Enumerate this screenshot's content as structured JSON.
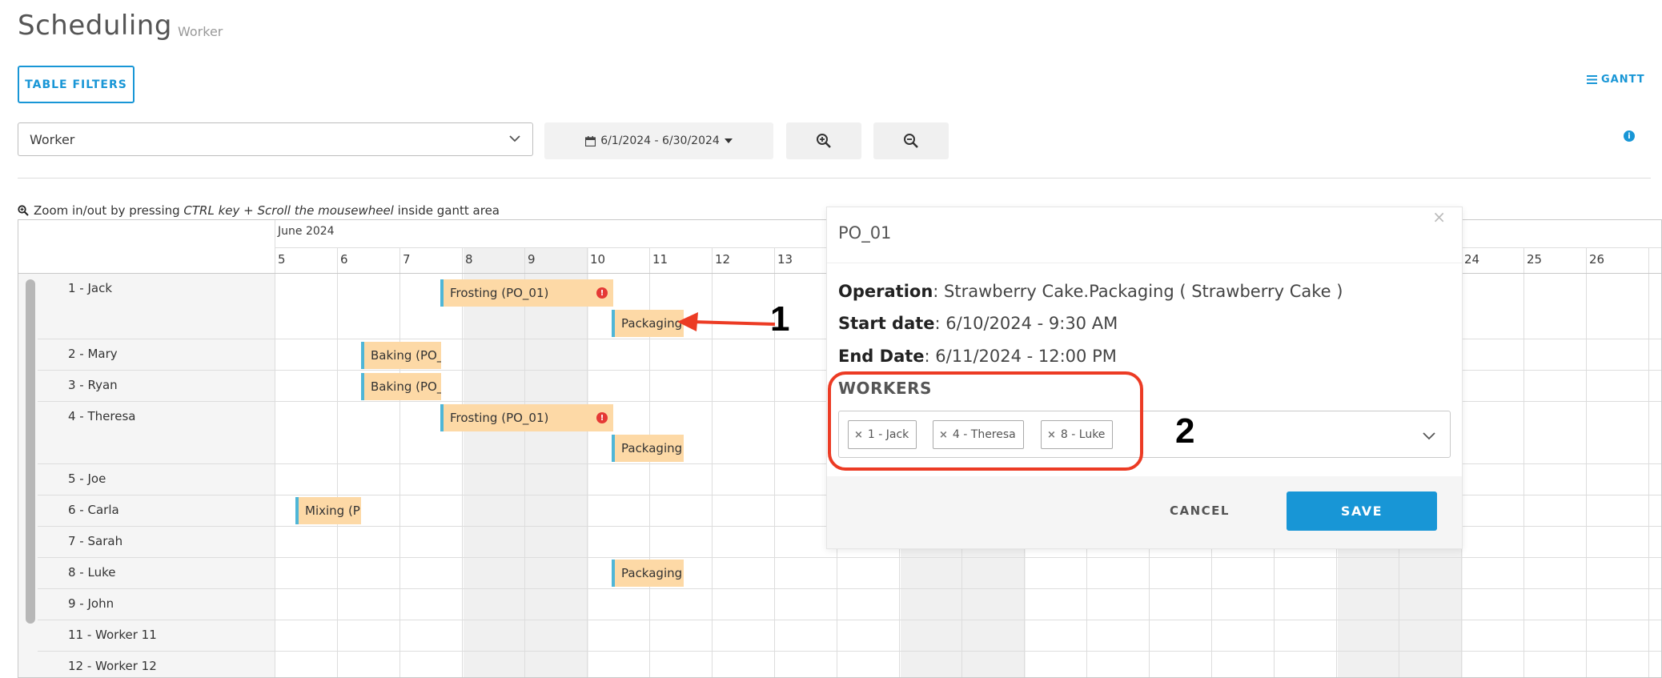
{
  "header": {
    "title": "Scheduling",
    "subtitle": "Worker"
  },
  "toolbar": {
    "filters_label": "TABLE FILTERS",
    "gantt_label": "GANTT",
    "view_select_value": "Worker",
    "date_range": "6/1/2024 - 6/30/2024",
    "zoom_hint_prefix": "Zoom in/out by pressing ",
    "zoom_hint_key": "CTRL key + Scroll the mousewheel",
    "zoom_hint_suffix": " inside gantt area"
  },
  "gantt": {
    "month": "June 2024",
    "days": [
      "5",
      "6",
      "7",
      "8",
      "9",
      "10",
      "11",
      "12",
      "13",
      "24",
      "25",
      "26"
    ],
    "rows": [
      "1 - Jack",
      "2 - Mary",
      "3 - Ryan",
      "4 - Theresa",
      "5 - Joe",
      "6 - Carla",
      "7 - Sarah",
      "8 - Luke",
      "9 - John",
      "11 - Worker 11",
      "12 - Worker 12"
    ],
    "tasks": [
      "Frosting (PO_01)",
      "Packaging",
      "Baking (PO_",
      "Baking (PO_",
      "Frosting (PO_01)",
      "Packaging",
      "Mixing (P",
      "Packaging"
    ]
  },
  "popup": {
    "title": "PO_01",
    "operation_label": "Operation",
    "operation_value": ": Strawberry Cake.Packaging ( Strawberry Cake )",
    "start_label": "Start date",
    "start_value": ": 6/10/2024 - 9:30 AM",
    "end_label": "End Date",
    "end_value": ": 6/11/2024 - 12:00 PM",
    "workers_heading": "WORKERS",
    "workers": [
      "1 - Jack",
      "4 - Theresa",
      "8 - Luke"
    ],
    "cancel_label": "CANCEL",
    "save_label": "SAVE"
  },
  "annotations": {
    "one": "1",
    "two": "2"
  },
  "colors": {
    "accent": "#1896d6",
    "task_fill": "#fdd9a6",
    "task_edge": "#4fb6d7",
    "warning": "#e53935",
    "annotation": "#ec3b24"
  },
  "icons": [
    "gantt-icon",
    "chevron-down-icon",
    "calendar-icon",
    "caret-down-icon",
    "zoom-in-icon",
    "zoom-out-icon",
    "info-icon",
    "search-icon",
    "warning-icon",
    "close-icon",
    "remove-chip-icon"
  ]
}
